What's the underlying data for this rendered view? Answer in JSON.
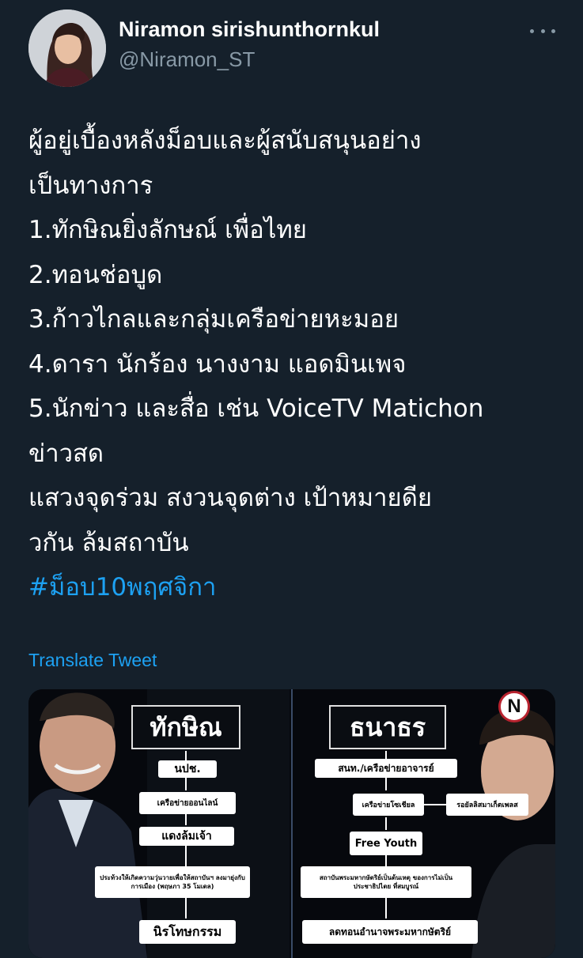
{
  "tweet": {
    "author": {
      "display_name": "Niramon sirishunthornkul",
      "handle": "@Niramon_ST",
      "avatar_icon": "profile-photo"
    },
    "more_icon": "more-horizontal-icon",
    "lines": [
      "ผู้อยู่เบื้องหลังม็อบและผู้สนับสนุนอย่าง",
      "เป็นทางการ",
      "1.ทักษิณยิ่งลักษณ์ เพื่อไทย",
      "2.ทอนช่อบูด",
      "3.ก้าวไกลและกลุ่มเครือข่ายหะมอย",
      "4.ดารา นักร้อง นางงาม แอดมินเพจ",
      "5.นักข่าว และสื่อ เช่น VoiceTV Matichon",
      "ข่าวสด",
      "แสวงจุดร่วม สงวนจุดต่าง เป้าหมายดีย",
      "วกัน ล้มสถาบัน"
    ],
    "hashtag": "#ม็อบ10พฤศจิกา",
    "translate_label": "Translate Tweet"
  },
  "media": {
    "logo_letter": "N",
    "left_column": {
      "title": "ทักษิณ",
      "boxes": [
        "นปช.",
        "เครือข่ายออนไลน์",
        "แดงล้มเจ้า",
        "ประท้วงให้เกิดความวุ่นวายเพื่อให้สถาบันฯ ลงมายุ่งกับการเมือง (พฤษภา 35 โมเดล)",
        "นิรโทษกรรม"
      ]
    },
    "right_column": {
      "title": "ธนาธร",
      "boxes": [
        "สนท./เครือข่ายอาจารย์",
        "เครือข่ายโซเชียล",
        "รอยัลลิสมาเก็ตเพลส",
        "Free Youth",
        "สถาบันพระมหากษัตริย์เป็นต้นเหตุ ของการไม่เป็นประชาธิปไตย ที่สมบูรณ์",
        "ลดทอนอำนาจพระมหากษัตริย์"
      ]
    }
  },
  "colors": {
    "background": "#15202b",
    "text": "#ffffff",
    "secondary": "#8899a6",
    "accent": "#1da1f2"
  }
}
